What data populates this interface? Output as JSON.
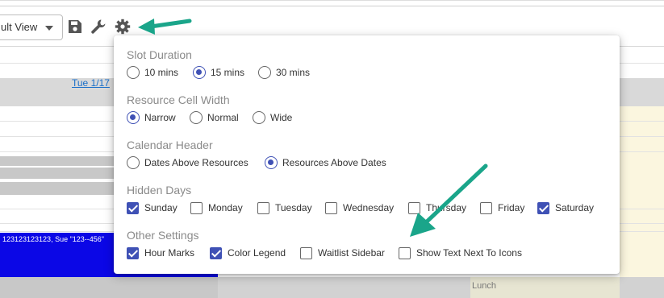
{
  "toolbar": {
    "view_select_value": "ult View",
    "save_icon": "save-icon",
    "wrench_icon": "wrench-icon",
    "gear_icon": "gear-icon"
  },
  "calendar": {
    "date_header": "Tue 1/17",
    "event_text": "123123123123, Sue \"123--456\"",
    "lunch_label": "Lunch"
  },
  "settings": {
    "slot_duration": {
      "title": "Slot Duration",
      "options": [
        {
          "label": "10 mins",
          "selected": false
        },
        {
          "label": "15 mins",
          "selected": true
        },
        {
          "label": "30 mins",
          "selected": false
        }
      ]
    },
    "cell_width": {
      "title": "Resource Cell Width",
      "options": [
        {
          "label": "Narrow",
          "selected": true
        },
        {
          "label": "Normal",
          "selected": false
        },
        {
          "label": "Wide",
          "selected": false
        }
      ]
    },
    "calendar_header": {
      "title": "Calendar Header",
      "options": [
        {
          "label": "Dates Above Resources",
          "selected": false
        },
        {
          "label": "Resources Above Dates",
          "selected": true
        }
      ]
    },
    "hidden_days": {
      "title": "Hidden Days",
      "options": [
        {
          "label": "Sunday",
          "checked": true
        },
        {
          "label": "Monday",
          "checked": false
        },
        {
          "label": "Tuesday",
          "checked": false
        },
        {
          "label": "Wednesday",
          "checked": false
        },
        {
          "label": "Thursday",
          "checked": false
        },
        {
          "label": "Friday",
          "checked": false
        },
        {
          "label": "Saturday",
          "checked": true
        }
      ]
    },
    "other_settings": {
      "title": "Other Settings",
      "options": [
        {
          "label": "Hour Marks",
          "checked": true
        },
        {
          "label": "Color Legend",
          "checked": true
        },
        {
          "label": "Waitlist Sidebar",
          "checked": false
        },
        {
          "label": "Show Text Next To Icons",
          "checked": false
        }
      ]
    }
  },
  "colors": {
    "accent": "#3f51b5",
    "arrow": "#1aa58a",
    "event": "#0b07e6"
  }
}
